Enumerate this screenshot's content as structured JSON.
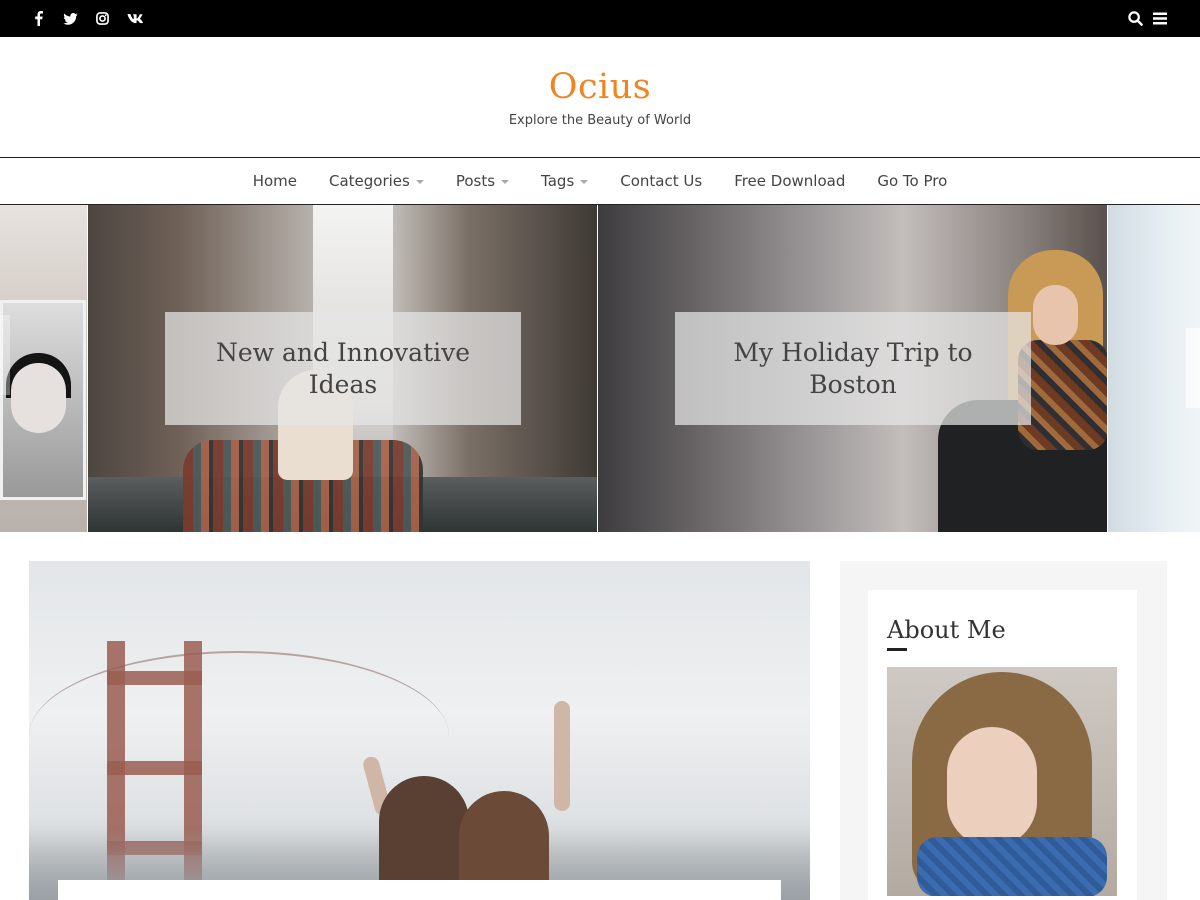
{
  "topbar": {
    "social": [
      {
        "name": "facebook-icon",
        "glyph": "f"
      },
      {
        "name": "twitter-icon",
        "glyph": "🐦"
      },
      {
        "name": "instagram-icon",
        "glyph": "◎"
      },
      {
        "name": "vk-icon",
        "glyph": "vk"
      }
    ],
    "search_icon": "search-icon",
    "menu_icon": "hamburger-menu-icon"
  },
  "site": {
    "title": "Ocius",
    "tagline": "Explore the Beauty of World",
    "accent_color": "#f08420"
  },
  "nav": {
    "items": [
      {
        "label": "Home",
        "has_dropdown": false
      },
      {
        "label": "Categories",
        "has_dropdown": true
      },
      {
        "label": "Posts",
        "has_dropdown": true
      },
      {
        "label": "Tags",
        "has_dropdown": true
      },
      {
        "label": "Contact Us",
        "has_dropdown": false
      },
      {
        "label": "Free Download",
        "has_dropdown": false
      },
      {
        "label": "Go To Pro",
        "has_dropdown": false
      }
    ]
  },
  "slider": {
    "slides": [
      {
        "caption": "New and Innovative Ideas"
      },
      {
        "caption": "My Holiday Trip to Boston"
      }
    ]
  },
  "sidebar": {
    "widget_title": "About Me"
  }
}
